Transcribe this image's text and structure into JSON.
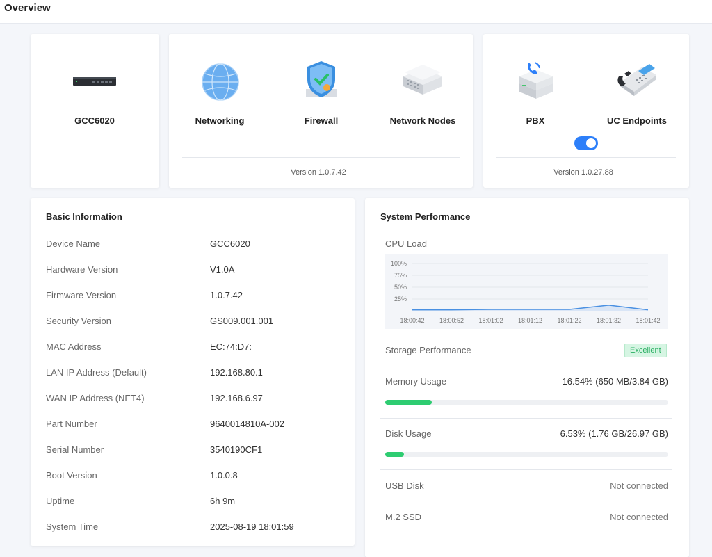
{
  "page": {
    "title": "Overview"
  },
  "device_card": {
    "name": "GCC6020",
    "icon": "router-device-icon"
  },
  "networking_card": {
    "items": [
      {
        "label": "Networking",
        "icon": "globe-icon"
      },
      {
        "label": "Firewall",
        "icon": "shield-icon"
      },
      {
        "label": "Network Nodes",
        "icon": "switch-stack-icon"
      }
    ],
    "version": "Version 1.0.7.42"
  },
  "pbx_card": {
    "items": [
      {
        "label": "PBX",
        "icon": "pbx-server-icon"
      },
      {
        "label": "UC Endpoints",
        "icon": "ip-phone-icon"
      }
    ],
    "toggle_on": true,
    "version": "Version 1.0.27.88"
  },
  "basic_info": {
    "title": "Basic Information",
    "rows": [
      {
        "label": "Device Name",
        "value": "GCC6020"
      },
      {
        "label": "Hardware Version",
        "value": "V1.0A"
      },
      {
        "label": "Firmware Version",
        "value": "1.0.7.42"
      },
      {
        "label": "Security Version",
        "value": "GS009.001.001"
      },
      {
        "label": "MAC Address",
        "value": "EC:74:D7:"
      },
      {
        "label": "LAN IP Address (Default)",
        "value": "192.168.80.1"
      },
      {
        "label": "WAN IP Address (NET4)",
        "value": "192.168.6.97"
      },
      {
        "label": "Part Number",
        "value": "9640014810A-002"
      },
      {
        "label": "Serial Number",
        "value": "3540190CF1"
      },
      {
        "label": "Boot Version",
        "value": "1.0.0.8"
      },
      {
        "label": "Uptime",
        "value": "6h 9m"
      },
      {
        "label": "System Time",
        "value": "2025-08-19 18:01:59"
      }
    ]
  },
  "system_performance": {
    "title": "System Performance",
    "cpu": {
      "label": "CPU Load"
    },
    "storage": {
      "label": "Storage Performance",
      "badge": "Excellent"
    },
    "memory": {
      "label": "Memory Usage",
      "value": "16.54% (650 MB/3.84 GB)",
      "percent": 16.54
    },
    "disk": {
      "label": "Disk Usage",
      "value": "6.53% (1.76 GB/26.97 GB)",
      "percent": 6.53
    },
    "usb": {
      "label": "USB Disk",
      "value": "Not connected"
    },
    "m2": {
      "label": "M.2 SSD",
      "value": "Not connected"
    },
    "colors": {
      "bar_fill": "#2ecc71",
      "line": "#4a90e2",
      "toggle": "#2d7ff9",
      "badge_text": "#27ae60"
    }
  },
  "chart_data": {
    "type": "area",
    "title": "CPU Load",
    "x": [
      "18:00:42",
      "18:00:52",
      "18:01:02",
      "18:01:12",
      "18:01:22",
      "18:01:32",
      "18:01:42"
    ],
    "y_ticks": [
      "100%",
      "75%",
      "50%",
      "25%"
    ],
    "series": [
      {
        "values": [
          2,
          2,
          3,
          3,
          3,
          12,
          2
        ]
      }
    ],
    "ylim": [
      0,
      100
    ],
    "grid": true
  }
}
